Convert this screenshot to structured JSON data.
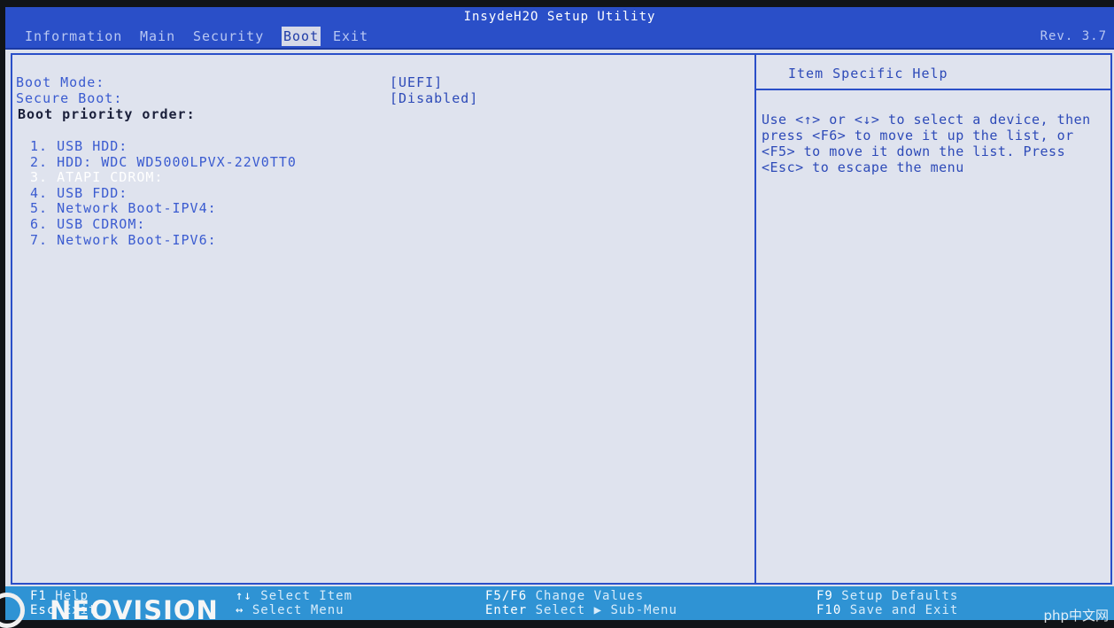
{
  "title": "InsydeH2O Setup Utility",
  "revision": "Rev. 3.7",
  "menu": [
    {
      "label": "Information",
      "active": false
    },
    {
      "label": "Main",
      "active": false
    },
    {
      "label": "Security",
      "active": false
    },
    {
      "label": "Boot",
      "active": true
    },
    {
      "label": "Exit",
      "active": false
    }
  ],
  "settings": {
    "boot_mode": {
      "label": "Boot Mode:",
      "value": "[UEFI]"
    },
    "secure_boot": {
      "label": "Secure Boot:",
      "value": "[Disabled]"
    },
    "priority_heading": "Boot priority order:"
  },
  "boot_order": [
    "1. USB HDD:",
    "2. HDD: WDC WD5000LPVX-22V0TT0",
    "3. ATAPI CDROM:",
    "4. USB FDD:",
    "5. Network Boot-IPV4:",
    "6. USB CDROM:",
    "7. Network Boot-IPV6:"
  ],
  "selected_boot_index": 2,
  "help": {
    "title": "Item Specific Help",
    "text": "Use <↑> or <↓> to select a device, then press <F6> to move it up the list, or <F5> to move it down the list. Press <Esc> to escape the menu"
  },
  "footer": {
    "f1": {
      "key": "F1",
      "desc": "Help"
    },
    "esc": {
      "key": "Esc",
      "desc": "Exit"
    },
    "updown": {
      "key": "↑↓",
      "desc": "Select Item"
    },
    "leftright": {
      "key": "↔",
      "desc": "Select Menu"
    },
    "f5f6": {
      "key": "F5/F6",
      "desc": "Change Values"
    },
    "enter": {
      "key": "Enter",
      "desc": "Select ▶ Sub-Menu"
    },
    "f9": {
      "key": "F9",
      "desc": "Setup Defaults"
    },
    "f10": {
      "key": "F10",
      "desc": "Save and Exit"
    }
  },
  "overlay": {
    "brand": "NEOVISION",
    "watermark": "php中文网"
  },
  "colors": {
    "title_bar": "#2a4fc8",
    "background": "#dde1ec",
    "footer_bar": "#2f93d4"
  }
}
